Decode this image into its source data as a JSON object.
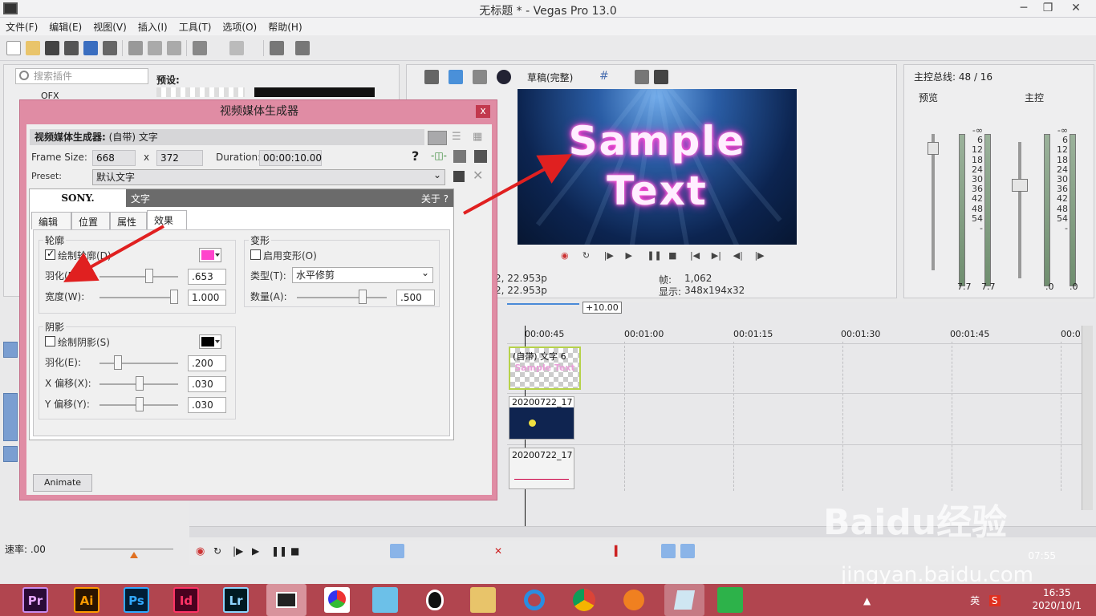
{
  "window": {
    "title": "无标题 * - Vegas Pro 13.0"
  },
  "menu": [
    "文件(F)",
    "编辑(E)",
    "视图(V)",
    "插入(I)",
    "工具(T)",
    "选项(O)",
    "帮助(H)"
  ],
  "plugins": {
    "search_placeholder": "搜索插件",
    "ofx_label": "OFX",
    "preset_label": "预设:"
  },
  "preview": {
    "quality": "草稿(完整)",
    "sample_line1": "Sample",
    "sample_line2": "Text",
    "project_line1": "2, 22.953p",
    "project_line2": "2, 22.953p",
    "frame_label": "帧:",
    "frame_value": "1,062",
    "display_label": "显示:",
    "display_value": "348x194x32"
  },
  "master": {
    "title": "主控总线: 48 / 16",
    "preview_label": "预览",
    "main_label": "主控",
    "scale": [
      "-∞",
      "6",
      "12",
      "18",
      "24",
      "30",
      "36",
      "42",
      "48",
      "54",
      "-"
    ],
    "left_vals": [
      "7.7",
      "7.7"
    ],
    "right_vals": [
      ".0",
      ".0"
    ]
  },
  "timeline": {
    "offset": "+10.00",
    "ticks": [
      "00:00:45",
      "00:01:00",
      "00:01:15",
      "00:01:30",
      "00:01:45",
      "00:0"
    ],
    "clip1": "(自带) 文字 6",
    "clip1_sub": "Sample Text",
    "clip2": "20200722_17",
    "clip3": "20200722_17",
    "time_end": "07:55",
    "rate": "速率: .00"
  },
  "dialog": {
    "title": "视频媒体生成器",
    "close": "x",
    "gen_label": "视频媒体生成器:",
    "gen_value": "(自带) 文字",
    "frame_size_label": "Frame Size:",
    "width": "668",
    "x": "x",
    "height": "372",
    "duration_label": "Duration:",
    "duration": "00:00:10.00",
    "preset_label": "Preset:",
    "preset_value": "默认文字",
    "sony": "SONY.",
    "plugin_title": "文字",
    "about": "关于 ?",
    "tabs": [
      "编辑",
      "位置",
      "属性",
      "效果"
    ],
    "outline": {
      "title": "轮廓",
      "draw_label": "绘制轮廓(D)",
      "color": "#ff44cc",
      "feather_label": "羽化(F):",
      "feather_value": ".653",
      "feather_frac": 0.653,
      "width_label": "宽度(W):",
      "width_value": "1.000",
      "width_frac": 1.0
    },
    "shadow": {
      "title": "阴影",
      "draw_label": "绘制阴影(S)",
      "color": "#000000",
      "feather_label": "羽化(E):",
      "feather_value": ".200",
      "feather_frac": 0.2,
      "xoff_label": "X 偏移(X):",
      "xoff_value": ".030",
      "xoff_frac": 0.515,
      "yoff_label": "Y 偏移(Y):",
      "yoff_value": ".030",
      "yoff_frac": 0.515
    },
    "transform": {
      "title": "变形",
      "enable_label": "启用变形(O)",
      "type_label": "类型(T):",
      "type_value": "水平修剪",
      "amount_label": "数量(A):",
      "amount_value": ".500",
      "amount_frac": 0.75
    },
    "animate": "Animate"
  },
  "taskbar": {
    "apps": [
      "Pr",
      "Ai",
      "Ps",
      "Id",
      "Lr"
    ],
    "time": "16:35",
    "date": "2020/10/1",
    "ime": "英"
  },
  "watermark": {
    "text": "Baidu经验",
    "url": "jingyan.baidu.com"
  }
}
